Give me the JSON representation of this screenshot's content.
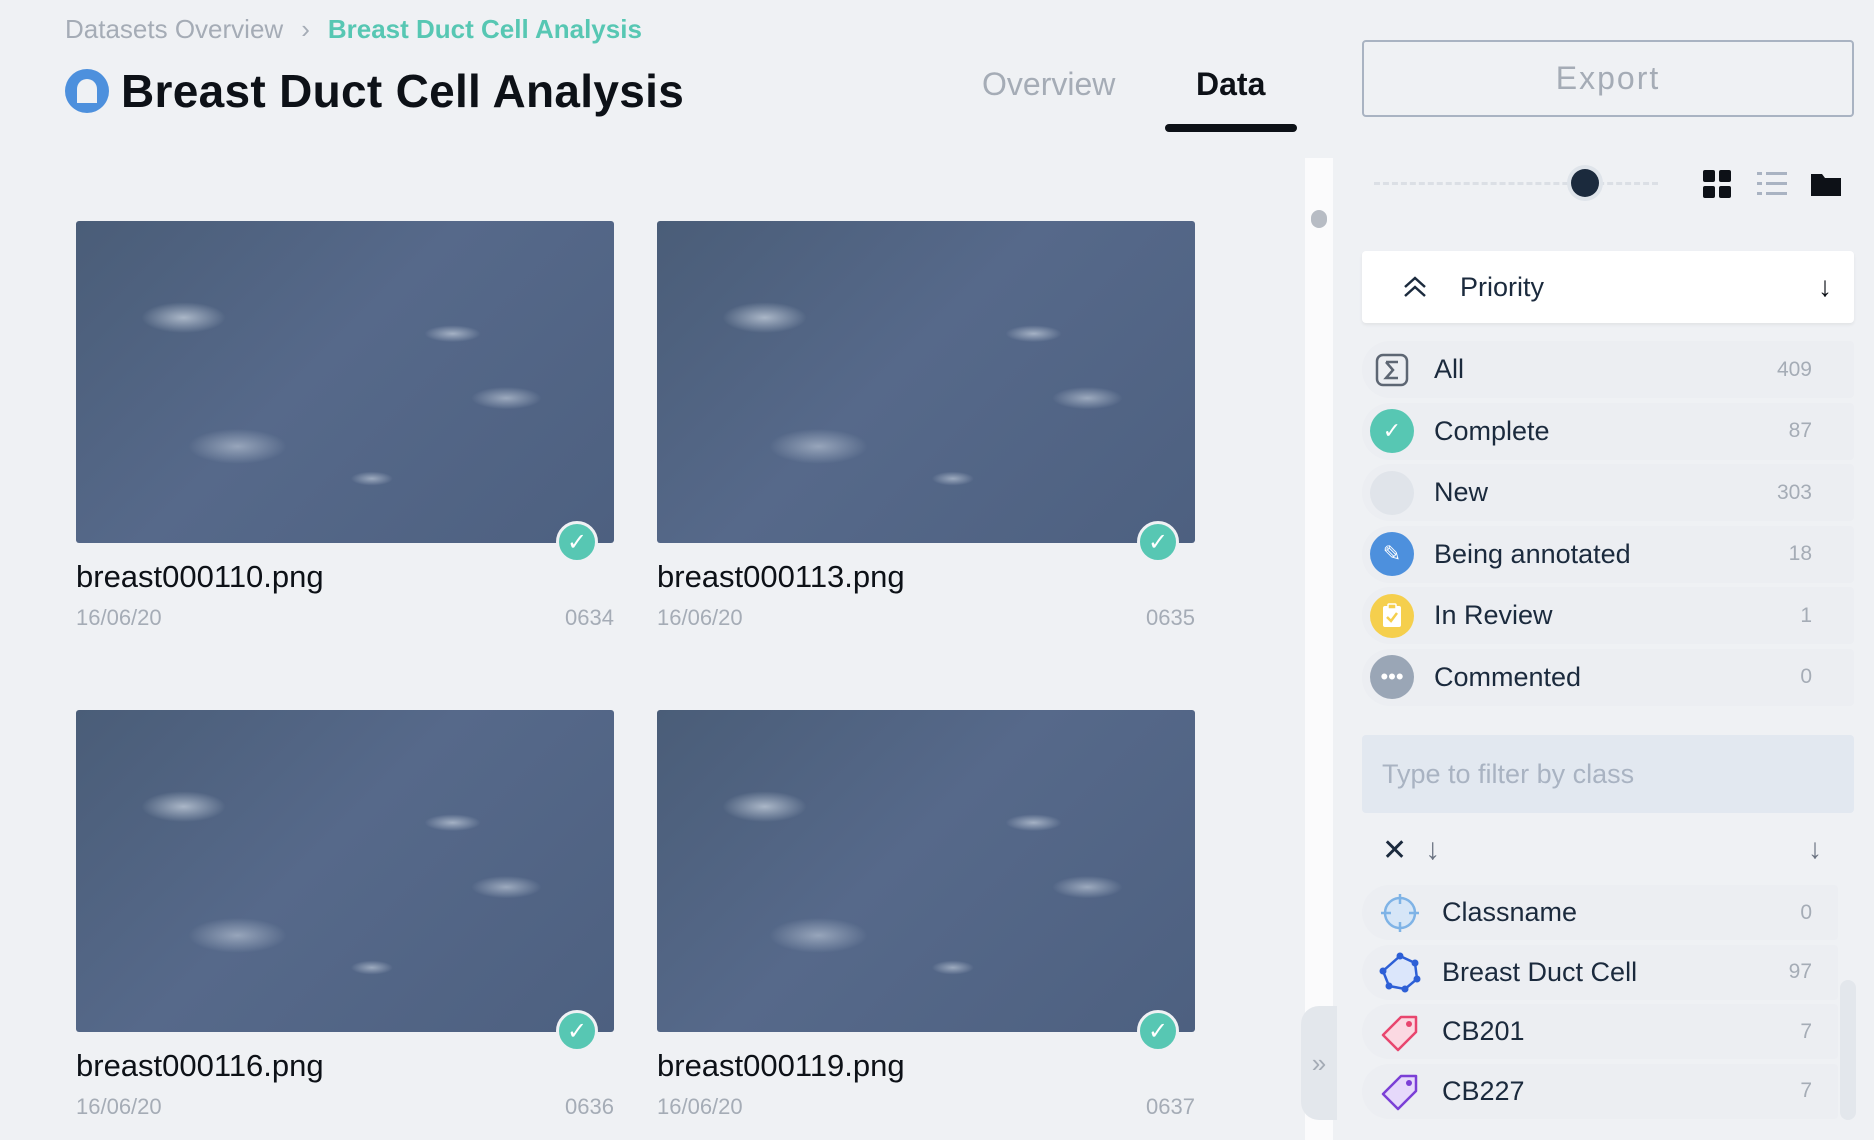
{
  "breadcrumb": {
    "parent": "Datasets Overview",
    "separator": "›",
    "current": "Breast Duct Cell Analysis"
  },
  "page": {
    "title": "Breast Duct Cell Analysis"
  },
  "tabs": [
    {
      "label": "Overview"
    },
    {
      "label": "Data"
    }
  ],
  "export_label": "Export",
  "items": [
    {
      "filename": "breast000110.png",
      "date": "16/06/20",
      "id": "0634",
      "status": "complete"
    },
    {
      "filename": "breast000113.png",
      "date": "16/06/20",
      "id": "0635",
      "status": "complete"
    },
    {
      "filename": "breast000116.png",
      "date": "16/06/20",
      "id": "0636",
      "status": "complete"
    },
    {
      "filename": "breast000119.png",
      "date": "16/06/20",
      "id": "0637",
      "status": "complete"
    }
  ],
  "sort": {
    "label": "Priority",
    "direction_icon": "arrow-down-icon"
  },
  "status_filters": [
    {
      "label": "All",
      "count": "409",
      "icon": "sigma-icon",
      "color": "#eceef2"
    },
    {
      "label": "Complete",
      "count": "87",
      "icon": "check-icon",
      "color": "#57c7b3"
    },
    {
      "label": "New",
      "count": "303",
      "icon": "circle-icon",
      "color": "#e0e4ea"
    },
    {
      "label": "Being annotated",
      "count": "18",
      "icon": "pencil-icon",
      "color": "#4d90dd"
    },
    {
      "label": "In Review",
      "count": "1",
      "icon": "clipboard-icon",
      "color": "#f5cf4d"
    },
    {
      "label": "Commented",
      "count": "0",
      "icon": "comment-icon",
      "color": "#9aa6b6"
    }
  ],
  "class_filter": {
    "placeholder": "Type to filter by class"
  },
  "classes": [
    {
      "label": "Classname",
      "count": "0",
      "icon": "crosshair-icon",
      "color": "#7fb3e6"
    },
    {
      "label": "Breast Duct Cell",
      "count": "97",
      "icon": "polygon-icon",
      "color": "#2d5fd6"
    },
    {
      "label": "CB201",
      "count": "7",
      "icon": "tag-icon",
      "color": "#e8466e"
    },
    {
      "label": "CB227",
      "count": "7",
      "icon": "tag-icon",
      "color": "#7b3fd6"
    }
  ],
  "slider": {
    "thumbnail_size_fraction": 0.75
  },
  "colors": {
    "accent": "#57c7b3",
    "background": "#eff1f4",
    "primary_text": "#0d1117"
  }
}
